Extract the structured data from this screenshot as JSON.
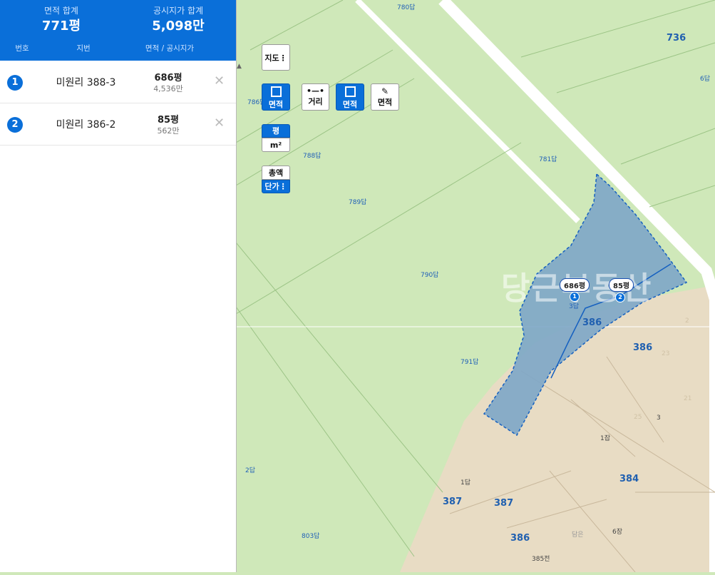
{
  "summary": {
    "area_label": "면적 합계",
    "area_value": "771평",
    "price_label": "공시지가 합계",
    "price_value": "5,098만"
  },
  "columns": {
    "num": "번호",
    "jibun": "지번",
    "area_price": "면적 / 공시지가"
  },
  "parcels": [
    {
      "num": "1",
      "jibun": "미원리 388-3",
      "area": "686평",
      "price": "4,536만"
    },
    {
      "num": "2",
      "jibun": "미원리 386-2",
      "area": "85평",
      "price": "562만"
    }
  ],
  "toolbar": {
    "map_btn": "지도",
    "area_btn": "면적",
    "distance_btn": "거리",
    "area_btn2": "면적",
    "area_btn3": "면적",
    "unit_pyeong": "평",
    "unit_m2": "m²",
    "total_btn": "총액",
    "unit_price_btn": "단가"
  },
  "map": {
    "labels": [
      "780답",
      "736",
      "6답",
      "786답",
      "788답",
      "781답",
      "789답",
      "790답",
      "791답",
      "3답",
      "386",
      "386",
      "23",
      "3",
      "1잡",
      "21",
      "25",
      "1답",
      "387",
      "387",
      "384",
      "386",
      "385전",
      "803답",
      "2답",
      "담은",
      "6장",
      "2"
    ],
    "bubble1": "686평",
    "bubble2": "85평",
    "pin1": "1",
    "pin2": "2",
    "watermark": "당근부동산"
  },
  "colors": {
    "accent": "#0a6fd9",
    "parcel_fill": "#7da6c8",
    "farmland": "#cfe8b9",
    "residential": "#e8dcc4"
  }
}
